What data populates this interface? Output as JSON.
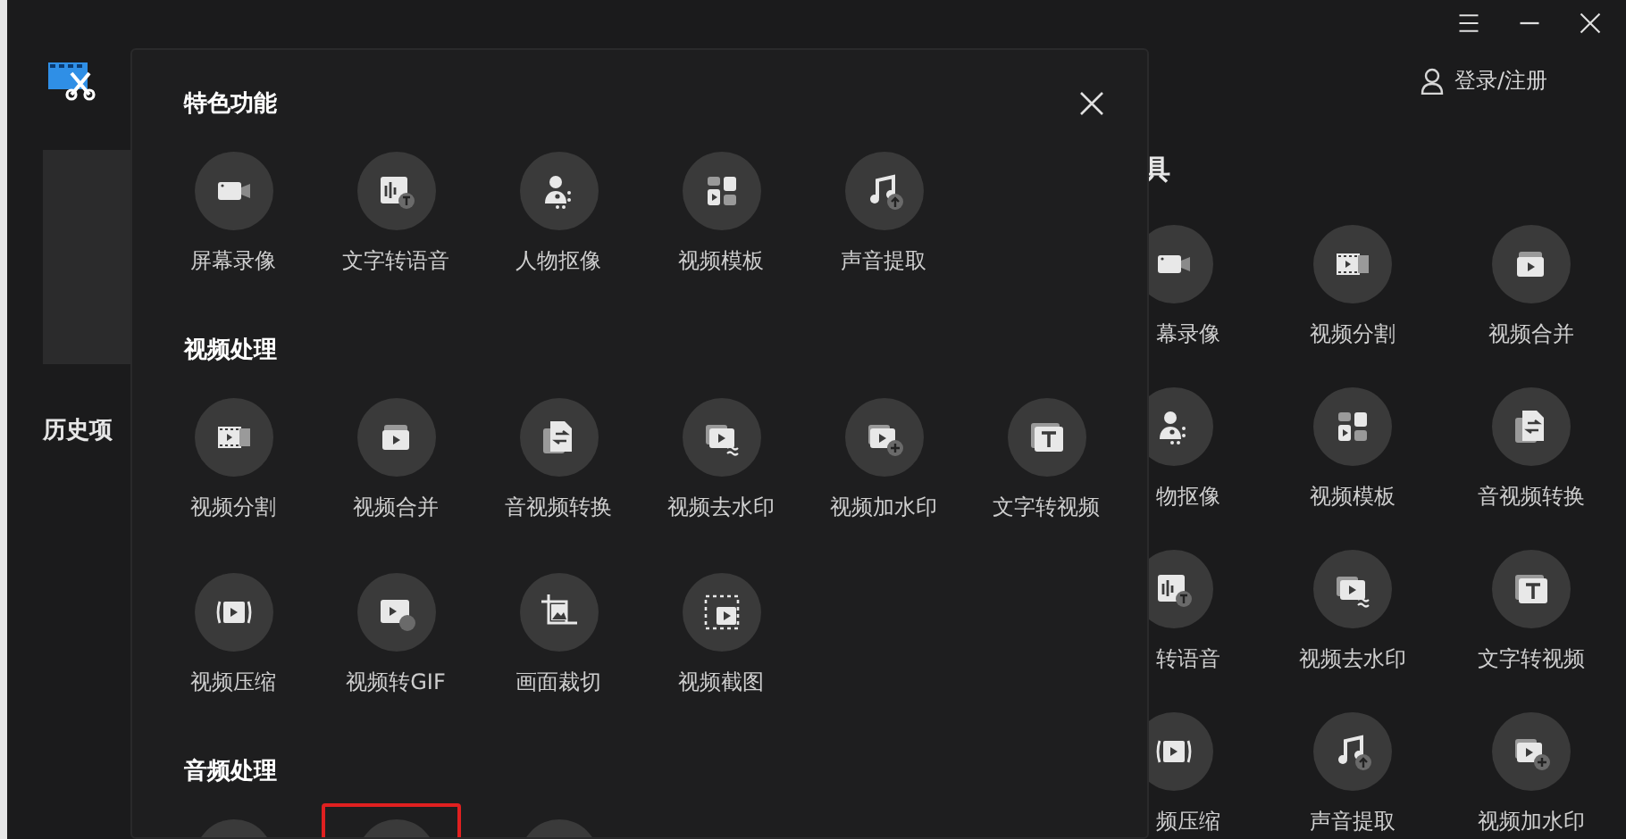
{
  "window_controls": [
    {
      "kind": "menu"
    },
    {
      "kind": "minimize"
    },
    {
      "kind": "close"
    }
  ],
  "account": {
    "label": "登录/注册"
  },
  "sidebar": {
    "history_label": "历史项"
  },
  "tools_panel": {
    "title": "具",
    "items": [
      {
        "kind": "record",
        "label": "幕录像"
      },
      {
        "kind": "split",
        "label": "视频分割"
      },
      {
        "kind": "merge",
        "label": "视频合并"
      },
      {
        "kind": "portrait",
        "label": "物抠像"
      },
      {
        "kind": "template",
        "label": "视频模板"
      },
      {
        "kind": "convert",
        "label": "音视频转换"
      },
      {
        "kind": "tts",
        "label": "转语音"
      },
      {
        "kind": "unmark",
        "label": "视频去水印"
      },
      {
        "kind": "textvideo",
        "label": "文字转视频"
      },
      {
        "kind": "compress",
        "label": "频压缩"
      },
      {
        "kind": "audio",
        "label": "声音提取"
      },
      {
        "kind": "mark",
        "label": "视频加水印"
      }
    ]
  },
  "dialog": {
    "sections": [
      {
        "title": "特色功能",
        "items": [
          {
            "kind": "record",
            "label": "屏幕录像"
          },
          {
            "kind": "tts",
            "label": "文字转语音"
          },
          {
            "kind": "portrait",
            "label": "人物抠像"
          },
          {
            "kind": "template",
            "label": "视频模板"
          },
          {
            "kind": "audio",
            "label": "声音提取"
          }
        ]
      },
      {
        "title": "视频处理",
        "items": [
          {
            "kind": "split",
            "label": "视频分割"
          },
          {
            "kind": "merge",
            "label": "视频合并"
          },
          {
            "kind": "convert",
            "label": "音视频转换"
          },
          {
            "kind": "unmark",
            "label": "视频去水印"
          },
          {
            "kind": "mark",
            "label": "视频加水印"
          },
          {
            "kind": "textvideo",
            "label": "文字转视频"
          },
          {
            "kind": "compress",
            "label": "视频压缩"
          },
          {
            "kind": "gif",
            "label": "视频转GIF"
          },
          {
            "kind": "crop",
            "label": "画面裁切"
          },
          {
            "kind": "screenshot",
            "label": "视频截图"
          }
        ]
      },
      {
        "title": "音频处理",
        "items": [
          {
            "kind": "partial",
            "highlighted": false
          },
          {
            "kind": "partial",
            "highlighted": true
          },
          {
            "kind": "partial",
            "highlighted": false
          }
        ]
      }
    ]
  }
}
